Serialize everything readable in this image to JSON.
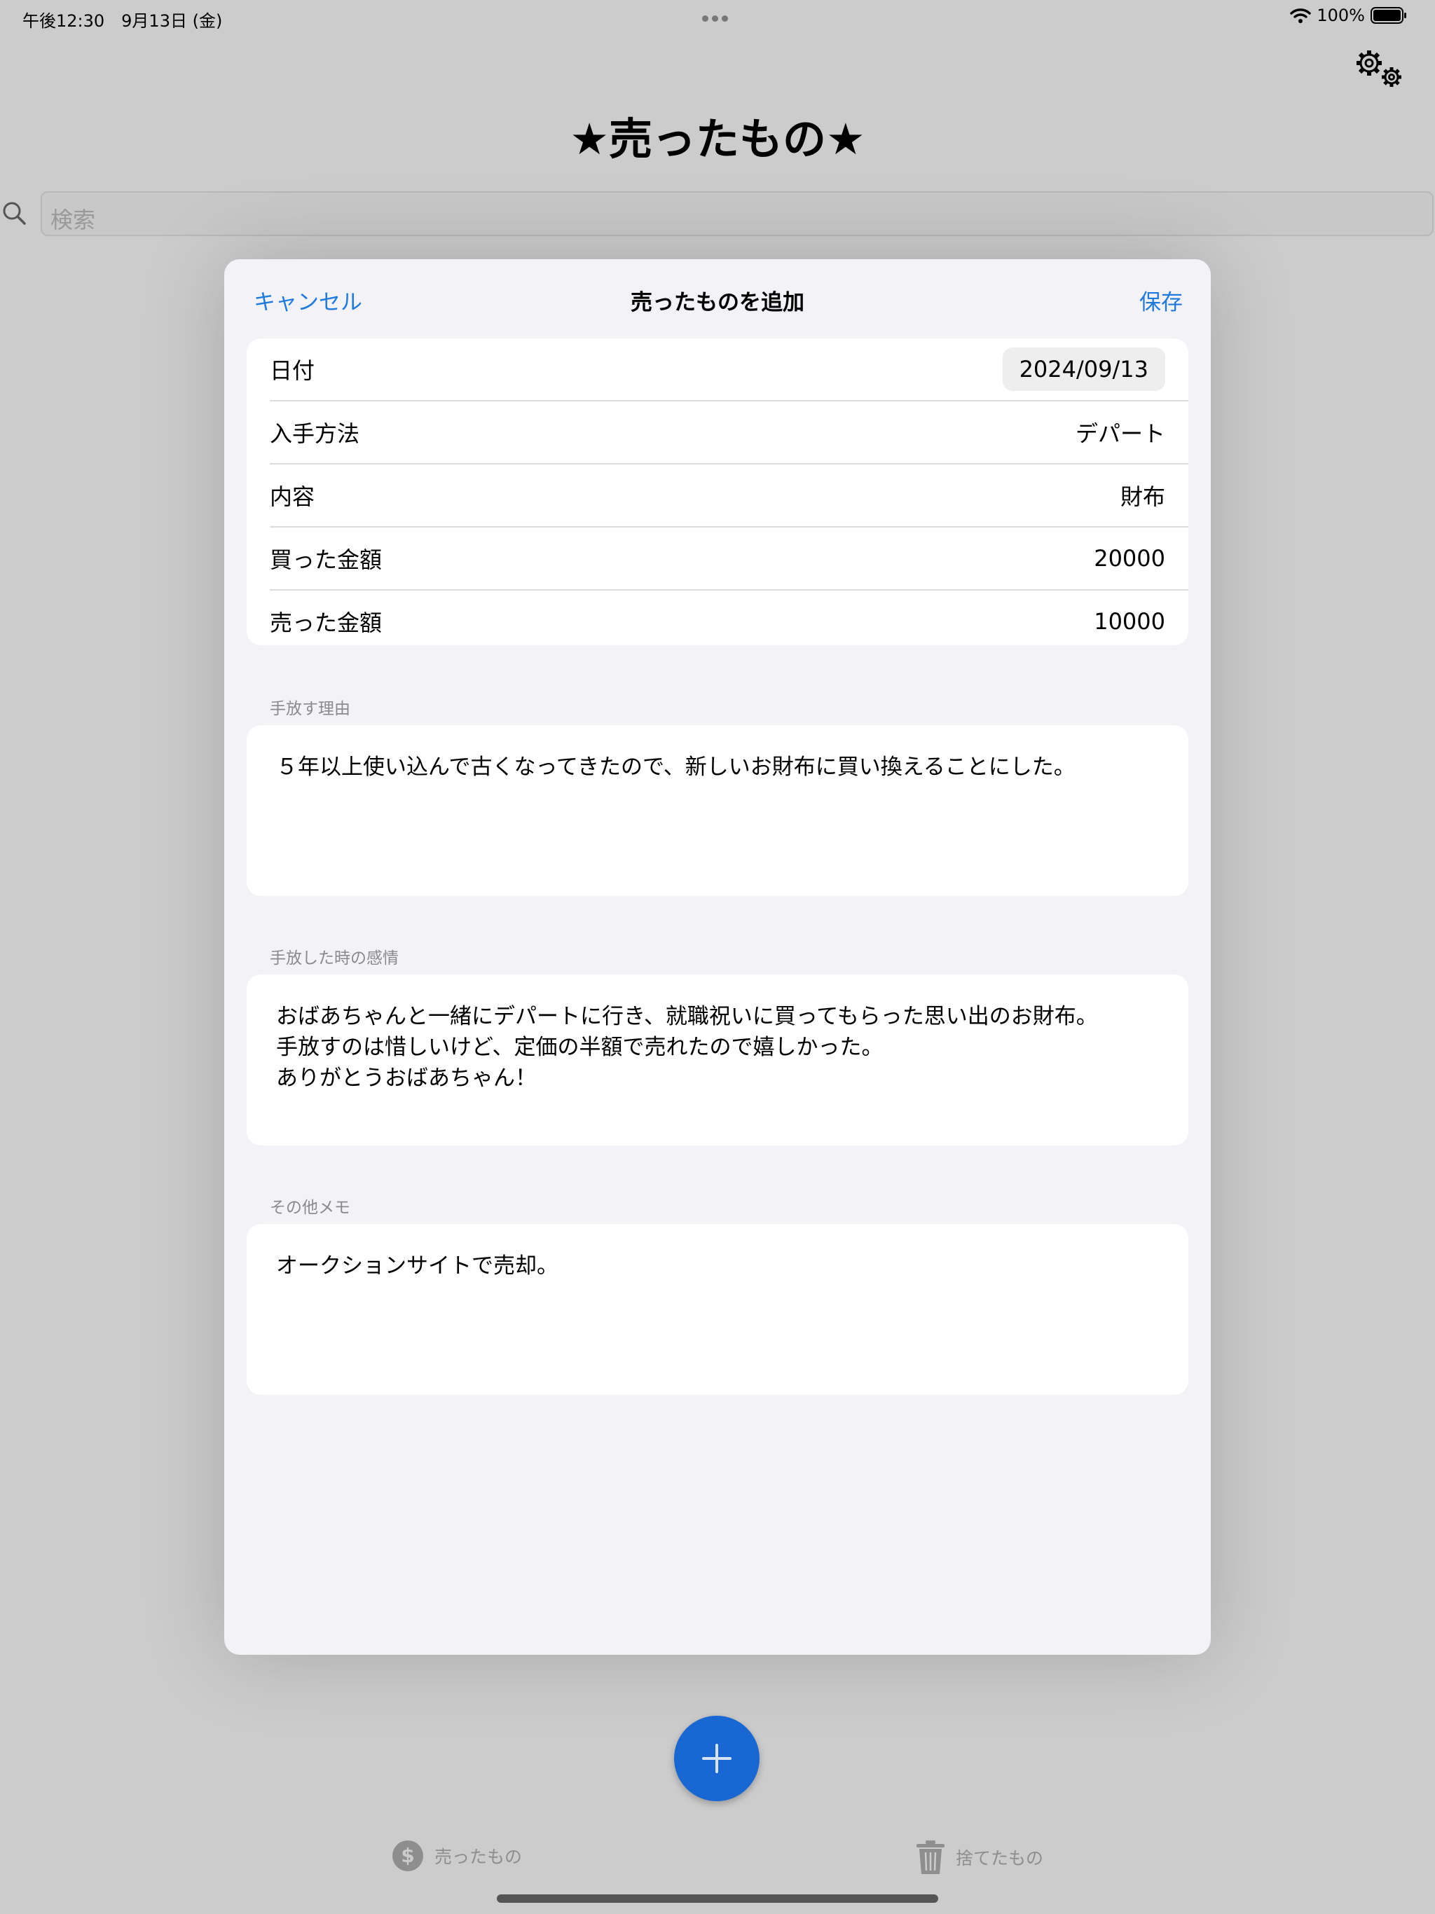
{
  "status_bar": {
    "time_date": "午後12:30　9月13日 (金)",
    "battery_percent": "100%",
    "battery_level": 1.0
  },
  "app": {
    "title": "★売ったもの★",
    "search_placeholder": "検索"
  },
  "modal": {
    "cancel_label": "キャンセル",
    "title": "売ったものを追加",
    "save_label": "保存",
    "fields": [
      {
        "label": "日付",
        "value": "2024/09/13"
      },
      {
        "label": "入手方法",
        "value": "デパート"
      },
      {
        "label": "内容",
        "value": "財布"
      },
      {
        "label": "買った金額",
        "value": "20000"
      },
      {
        "label": "売った金額",
        "value": "10000"
      }
    ],
    "sections": [
      {
        "label": "手放す理由",
        "text": "５年以上使い込んで古くなってきたので、新しいお財布に買い換えることにした。"
      },
      {
        "label": "手放した時の感情",
        "text": "おばあちゃんと一緒にデパートに行き、就職祝いに買ってもらった思い出のお財布。\n手放すのは惜しいけど、定価の半額で売れたので嬉しかった。\nありがとうおばあちゃん！"
      },
      {
        "label": "その他メモ",
        "text": "オークションサイトで売却。"
      }
    ]
  },
  "tabs": [
    {
      "label": "売ったもの",
      "icon": "dollar-circle-icon"
    },
    {
      "label": "捨てたもの",
      "icon": "trash-icon"
    }
  ],
  "colors": {
    "accent": "#1f7ae0",
    "fab": "#1967d2",
    "dim_background": "#cccccc"
  }
}
